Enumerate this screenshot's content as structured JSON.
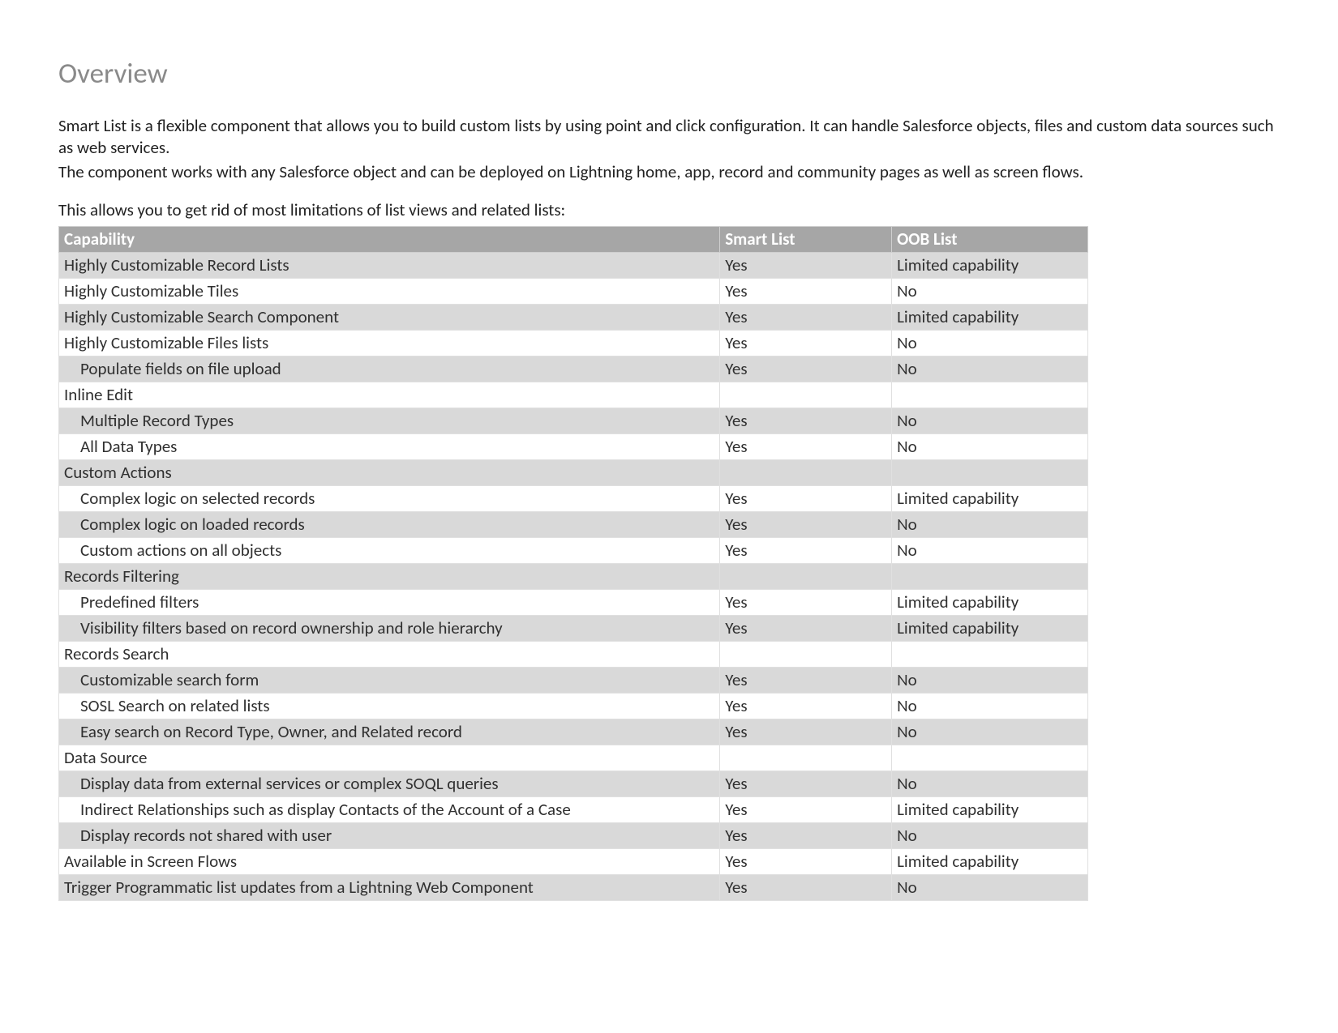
{
  "heading": "Overview",
  "paragraphs": [
    "Smart List is a flexible component that allows you to build custom lists by using point and click configuration. It can handle Salesforce objects, files and custom data sources such as web services.",
    "The component works with any Salesforce object and can be deployed on Lightning home, app, record and community pages as well as screen flows.",
    "This allows you to get rid of most limitations of list views and related lists:"
  ],
  "table": {
    "headers": [
      "Capability",
      "Smart List",
      "OOB List"
    ],
    "rows": [
      {
        "shade": true,
        "indent": 0,
        "cells": [
          "Highly Customizable Record Lists",
          "Yes",
          "Limited capability"
        ]
      },
      {
        "shade": false,
        "indent": 0,
        "cells": [
          "Highly Customizable Tiles",
          "Yes",
          "No"
        ]
      },
      {
        "shade": true,
        "indent": 0,
        "cells": [
          "Highly Customizable Search Component",
          "Yes",
          "Limited capability"
        ]
      },
      {
        "shade": false,
        "indent": 0,
        "cells": [
          "Highly Customizable Files lists",
          "Yes",
          "No"
        ]
      },
      {
        "shade": true,
        "indent": 1,
        "cells": [
          "Populate fields on file upload",
          "Yes",
          "No"
        ]
      },
      {
        "shade": false,
        "indent": 0,
        "cells": [
          "Inline Edit",
          "",
          ""
        ]
      },
      {
        "shade": true,
        "indent": 1,
        "cells": [
          "Multiple Record Types",
          "Yes",
          "No"
        ]
      },
      {
        "shade": false,
        "indent": 1,
        "cells": [
          "All Data Types",
          "Yes",
          "No"
        ]
      },
      {
        "shade": true,
        "indent": 0,
        "cells": [
          "Custom Actions",
          "",
          ""
        ]
      },
      {
        "shade": false,
        "indent": 1,
        "cells": [
          "Complex logic on selected records",
          "Yes",
          "Limited capability"
        ]
      },
      {
        "shade": true,
        "indent": 1,
        "cells": [
          "Complex logic on loaded records",
          "Yes",
          "No"
        ]
      },
      {
        "shade": false,
        "indent": 1,
        "cells": [
          "Custom actions on all objects",
          "Yes",
          "No"
        ]
      },
      {
        "shade": true,
        "indent": 0,
        "cells": [
          "Records Filtering",
          "",
          ""
        ]
      },
      {
        "shade": false,
        "indent": 1,
        "cells": [
          "Predefined filters",
          "Yes",
          "Limited capability"
        ]
      },
      {
        "shade": true,
        "indent": 1,
        "cells": [
          "Visibility filters based on record ownership and role hierarchy",
          "Yes",
          "Limited capability"
        ]
      },
      {
        "shade": false,
        "indent": 0,
        "cells": [
          "Records Search",
          "",
          ""
        ]
      },
      {
        "shade": true,
        "indent": 1,
        "cells": [
          "Customizable search form",
          "Yes",
          "No"
        ]
      },
      {
        "shade": false,
        "indent": 1,
        "cells": [
          "SOSL Search on related lists",
          "Yes",
          "No"
        ]
      },
      {
        "shade": true,
        "indent": 1,
        "cells": [
          "Easy search on Record Type, Owner, and Related record",
          "Yes",
          "No"
        ]
      },
      {
        "shade": false,
        "indent": 0,
        "cells": [
          "Data Source",
          "",
          ""
        ]
      },
      {
        "shade": true,
        "indent": 1,
        "cells": [
          "Display data from external services or complex SOQL queries",
          "Yes",
          "No"
        ]
      },
      {
        "shade": false,
        "indent": 1,
        "cells": [
          "Indirect Relationships such as display Contacts of the Account of a Case",
          "Yes",
          "Limited capability"
        ]
      },
      {
        "shade": true,
        "indent": 1,
        "cells": [
          "Display records not shared with user",
          "Yes",
          "No"
        ]
      },
      {
        "shade": false,
        "indent": 0,
        "cells": [
          "Available in Screen Flows",
          "Yes",
          "Limited capability"
        ]
      },
      {
        "shade": true,
        "indent": 0,
        "cells": [
          "Trigger Programmatic list updates from a Lightning Web Component",
          "Yes",
          "No"
        ]
      }
    ]
  }
}
